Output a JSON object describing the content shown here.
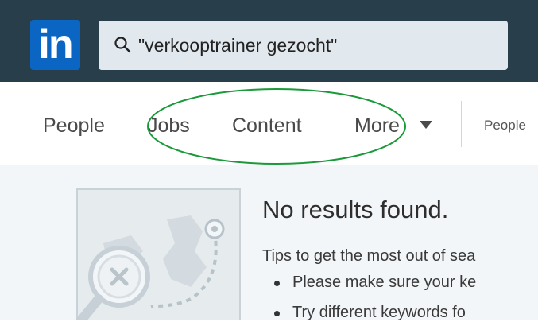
{
  "header": {
    "logo_text": "in",
    "search": {
      "value": "\"verkooptrainer gezocht\""
    }
  },
  "nav": {
    "tabs": [
      {
        "label": "People"
      },
      {
        "label": "Jobs"
      },
      {
        "label": "Content"
      },
      {
        "label": "More"
      }
    ],
    "filter_label": "People"
  },
  "results": {
    "headline": "No results found.",
    "tips_intro": "Tips to get the most out of sea",
    "tips": [
      "Please make sure your ke",
      "Try different keywords fo"
    ]
  },
  "colors": {
    "topbar": "#283e4a",
    "logo": "#0a66c2",
    "search_bg": "#e1e9ee",
    "highlight_ellipse": "#1a9a3a",
    "content_bg": "#f3f6f8"
  },
  "icons": [
    "linkedin-logo",
    "search-icon",
    "caret-down-icon",
    "no-results-illustration"
  ]
}
